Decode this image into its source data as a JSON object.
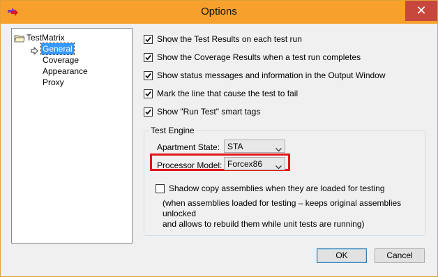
{
  "window": {
    "title": "Options",
    "close_glyph": "✕"
  },
  "tree": {
    "root_label": "TestMatrix",
    "items": [
      "General",
      "Coverage",
      "Appearance",
      "Proxy"
    ],
    "selected": "General"
  },
  "checkboxes": [
    {
      "label": "Show the Test Results on each test run",
      "checked": true
    },
    {
      "label": "Show the Coverage Results when a test run completes",
      "checked": true
    },
    {
      "label": "Show status messages and information in the Output Window",
      "checked": true
    },
    {
      "label": "Mark the line that cause the test to fail",
      "checked": true
    },
    {
      "label": "Show \"Run Test\" smart tags",
      "checked": true
    }
  ],
  "engine": {
    "group_title": "Test Engine",
    "apartment_label": "Apartment State:",
    "apartment_value": "STA",
    "processor_label": "Processor Model:",
    "processor_value": "Forcex86",
    "shadow_label": "Shadow copy assemblies when they are loaded for testing",
    "shadow_checked": false,
    "shadow_note_line1": "(when assemblies loaded for testing – keeps original assemblies unlocked",
    "shadow_note_line2": "and allows to rebuild them while unit tests are running)"
  },
  "buttons": {
    "ok": "OK",
    "cancel": "Cancel"
  },
  "colors": {
    "titlebar": "#f7a12c",
    "close": "#c7473c",
    "selection": "#3399ff",
    "annotation": "#e0151b"
  }
}
